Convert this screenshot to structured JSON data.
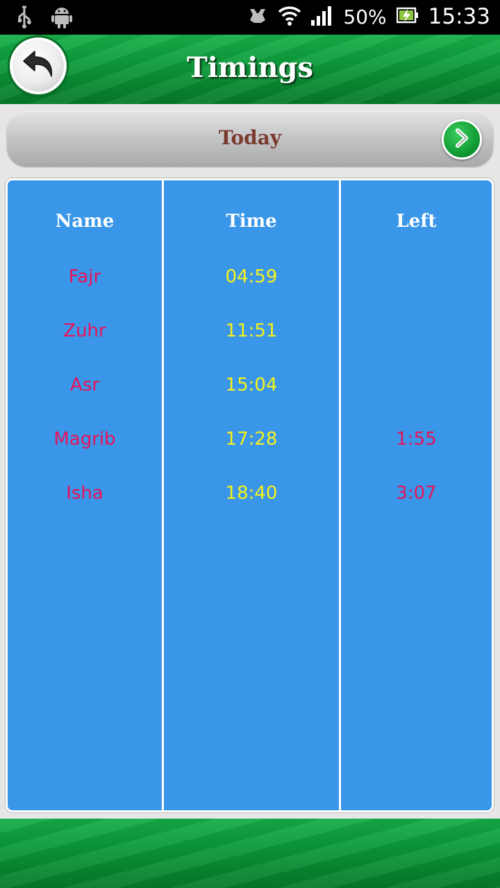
{
  "status_bar": {
    "battery": "50%",
    "time": "15:33",
    "icons": [
      "usb-icon",
      "android-icon",
      "sync-icon",
      "wifi-icon",
      "signal-icon",
      "battery-icon"
    ]
  },
  "header": {
    "title": "Timings",
    "back_icon": "back-arrow-icon"
  },
  "date_bar": {
    "label": "Today",
    "next_icon": "chevron-right-icon"
  },
  "table": {
    "columns": [
      "Name",
      "Time",
      "Left"
    ],
    "rows": [
      {
        "name": "Fajr",
        "time": "04:59",
        "left": ""
      },
      {
        "name": "Zuhr",
        "time": "11:51",
        "left": ""
      },
      {
        "name": "Asr",
        "time": "15:04",
        "left": ""
      },
      {
        "name": "Magrib",
        "time": "17:28",
        "left": "1:55"
      },
      {
        "name": "Isha",
        "time": "18:40",
        "left": "3:07"
      }
    ]
  },
  "colors": {
    "panel": "#3a96e8",
    "name_text": "#e8135a",
    "time_text": "#f7f21a",
    "header_green": "#0d9a3a"
  }
}
